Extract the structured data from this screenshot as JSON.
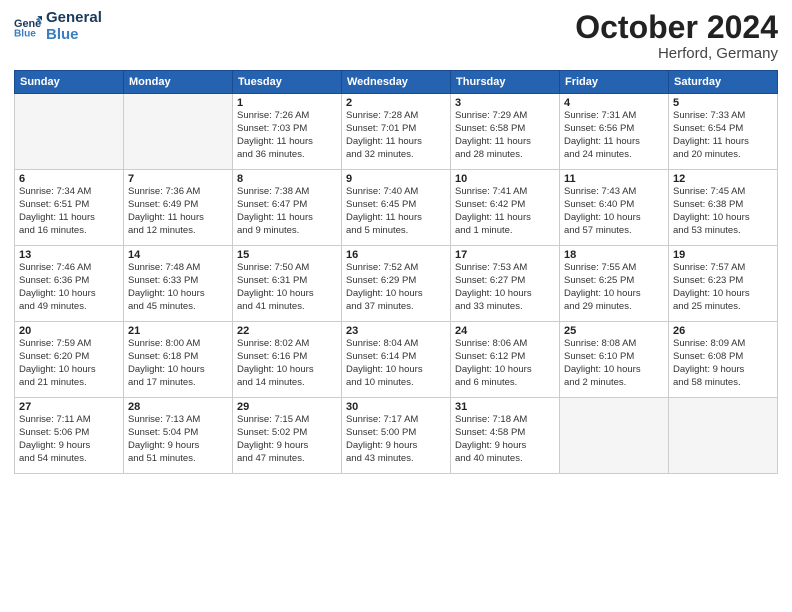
{
  "logo": {
    "line1": "General",
    "line2": "Blue"
  },
  "title": "October 2024",
  "location": "Herford, Germany",
  "days_header": [
    "Sunday",
    "Monday",
    "Tuesday",
    "Wednesday",
    "Thursday",
    "Friday",
    "Saturday"
  ],
  "weeks": [
    [
      {
        "day": "",
        "info": ""
      },
      {
        "day": "",
        "info": ""
      },
      {
        "day": "1",
        "info": "Sunrise: 7:26 AM\nSunset: 7:03 PM\nDaylight: 11 hours\nand 36 minutes."
      },
      {
        "day": "2",
        "info": "Sunrise: 7:28 AM\nSunset: 7:01 PM\nDaylight: 11 hours\nand 32 minutes."
      },
      {
        "day": "3",
        "info": "Sunrise: 7:29 AM\nSunset: 6:58 PM\nDaylight: 11 hours\nand 28 minutes."
      },
      {
        "day": "4",
        "info": "Sunrise: 7:31 AM\nSunset: 6:56 PM\nDaylight: 11 hours\nand 24 minutes."
      },
      {
        "day": "5",
        "info": "Sunrise: 7:33 AM\nSunset: 6:54 PM\nDaylight: 11 hours\nand 20 minutes."
      }
    ],
    [
      {
        "day": "6",
        "info": "Sunrise: 7:34 AM\nSunset: 6:51 PM\nDaylight: 11 hours\nand 16 minutes."
      },
      {
        "day": "7",
        "info": "Sunrise: 7:36 AM\nSunset: 6:49 PM\nDaylight: 11 hours\nand 12 minutes."
      },
      {
        "day": "8",
        "info": "Sunrise: 7:38 AM\nSunset: 6:47 PM\nDaylight: 11 hours\nand 9 minutes."
      },
      {
        "day": "9",
        "info": "Sunrise: 7:40 AM\nSunset: 6:45 PM\nDaylight: 11 hours\nand 5 minutes."
      },
      {
        "day": "10",
        "info": "Sunrise: 7:41 AM\nSunset: 6:42 PM\nDaylight: 11 hours\nand 1 minute."
      },
      {
        "day": "11",
        "info": "Sunrise: 7:43 AM\nSunset: 6:40 PM\nDaylight: 10 hours\nand 57 minutes."
      },
      {
        "day": "12",
        "info": "Sunrise: 7:45 AM\nSunset: 6:38 PM\nDaylight: 10 hours\nand 53 minutes."
      }
    ],
    [
      {
        "day": "13",
        "info": "Sunrise: 7:46 AM\nSunset: 6:36 PM\nDaylight: 10 hours\nand 49 minutes."
      },
      {
        "day": "14",
        "info": "Sunrise: 7:48 AM\nSunset: 6:33 PM\nDaylight: 10 hours\nand 45 minutes."
      },
      {
        "day": "15",
        "info": "Sunrise: 7:50 AM\nSunset: 6:31 PM\nDaylight: 10 hours\nand 41 minutes."
      },
      {
        "day": "16",
        "info": "Sunrise: 7:52 AM\nSunset: 6:29 PM\nDaylight: 10 hours\nand 37 minutes."
      },
      {
        "day": "17",
        "info": "Sunrise: 7:53 AM\nSunset: 6:27 PM\nDaylight: 10 hours\nand 33 minutes."
      },
      {
        "day": "18",
        "info": "Sunrise: 7:55 AM\nSunset: 6:25 PM\nDaylight: 10 hours\nand 29 minutes."
      },
      {
        "day": "19",
        "info": "Sunrise: 7:57 AM\nSunset: 6:23 PM\nDaylight: 10 hours\nand 25 minutes."
      }
    ],
    [
      {
        "day": "20",
        "info": "Sunrise: 7:59 AM\nSunset: 6:20 PM\nDaylight: 10 hours\nand 21 minutes."
      },
      {
        "day": "21",
        "info": "Sunrise: 8:00 AM\nSunset: 6:18 PM\nDaylight: 10 hours\nand 17 minutes."
      },
      {
        "day": "22",
        "info": "Sunrise: 8:02 AM\nSunset: 6:16 PM\nDaylight: 10 hours\nand 14 minutes."
      },
      {
        "day": "23",
        "info": "Sunrise: 8:04 AM\nSunset: 6:14 PM\nDaylight: 10 hours\nand 10 minutes."
      },
      {
        "day": "24",
        "info": "Sunrise: 8:06 AM\nSunset: 6:12 PM\nDaylight: 10 hours\nand 6 minutes."
      },
      {
        "day": "25",
        "info": "Sunrise: 8:08 AM\nSunset: 6:10 PM\nDaylight: 10 hours\nand 2 minutes."
      },
      {
        "day": "26",
        "info": "Sunrise: 8:09 AM\nSunset: 6:08 PM\nDaylight: 9 hours\nand 58 minutes."
      }
    ],
    [
      {
        "day": "27",
        "info": "Sunrise: 7:11 AM\nSunset: 5:06 PM\nDaylight: 9 hours\nand 54 minutes."
      },
      {
        "day": "28",
        "info": "Sunrise: 7:13 AM\nSunset: 5:04 PM\nDaylight: 9 hours\nand 51 minutes."
      },
      {
        "day": "29",
        "info": "Sunrise: 7:15 AM\nSunset: 5:02 PM\nDaylight: 9 hours\nand 47 minutes."
      },
      {
        "day": "30",
        "info": "Sunrise: 7:17 AM\nSunset: 5:00 PM\nDaylight: 9 hours\nand 43 minutes."
      },
      {
        "day": "31",
        "info": "Sunrise: 7:18 AM\nSunset: 4:58 PM\nDaylight: 9 hours\nand 40 minutes."
      },
      {
        "day": "",
        "info": ""
      },
      {
        "day": "",
        "info": ""
      }
    ]
  ]
}
